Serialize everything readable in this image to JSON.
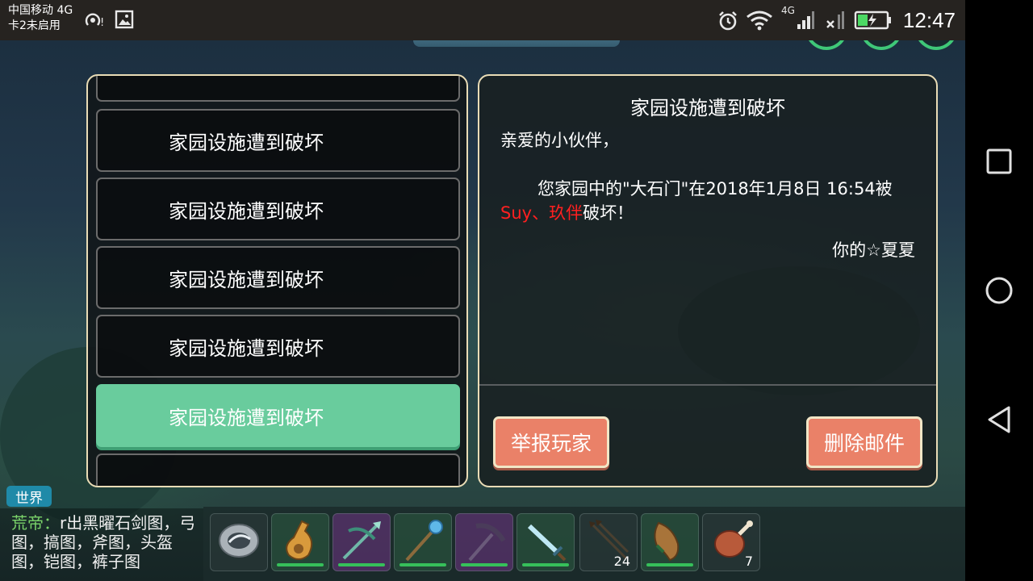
{
  "status_bar": {
    "carrier_line1": "中国移动 4G",
    "carrier_line2": "卡2未启用",
    "network_label": "4G",
    "time": "12:47"
  },
  "mail_list": {
    "items": [
      {
        "title": "家园设施遭到破坏",
        "selected": false
      },
      {
        "title": "家园设施遭到破坏",
        "selected": false
      },
      {
        "title": "家园设施遭到破坏",
        "selected": false
      },
      {
        "title": "家园设施遭到破坏",
        "selected": false
      },
      {
        "title": "家园设施遭到破坏",
        "selected": true
      }
    ]
  },
  "mail_detail": {
    "title": "家园设施遭到破坏",
    "greeting": "亲爱的小伙伴，",
    "body_prefix": "您家园中的\"大石门\"在2018年1月8日 16:54被",
    "attackers": "Suy、玖伴",
    "body_suffix": "破坏！",
    "signature": "你的☆夏夏",
    "report_button": "举报玩家",
    "delete_button": "删除邮件"
  },
  "chat": {
    "channel_tag": "世界",
    "speaker": "荒帝：",
    "message": "r出黑曜石剑图，弓图，搞图，斧图，头盔图，铠图，裤子图"
  },
  "item_bar": {
    "slots": [
      {
        "icon": "compass-disc-icon",
        "count": ""
      },
      {
        "icon": "water-gourd-icon",
        "count": ""
      },
      {
        "icon": "crossbow-icon",
        "count": ""
      },
      {
        "icon": "magic-staff-icon",
        "count": ""
      },
      {
        "icon": "pickaxe-icon",
        "count": ""
      },
      {
        "icon": "crystal-sword-icon",
        "count": ""
      },
      {
        "icon": "arrows-icon",
        "count": "24"
      },
      {
        "icon": "horn-flask-icon",
        "count": ""
      },
      {
        "icon": "roast-meat-icon",
        "count": "7"
      }
    ]
  },
  "colors": {
    "selected_item": "#69cc9d",
    "action_button": "#ea8168",
    "panel_border": "#e9dcb6",
    "attacker_text": "#ff2020",
    "chat_speaker": "#7ad36a",
    "chat_tag": "#1f8aa8"
  }
}
